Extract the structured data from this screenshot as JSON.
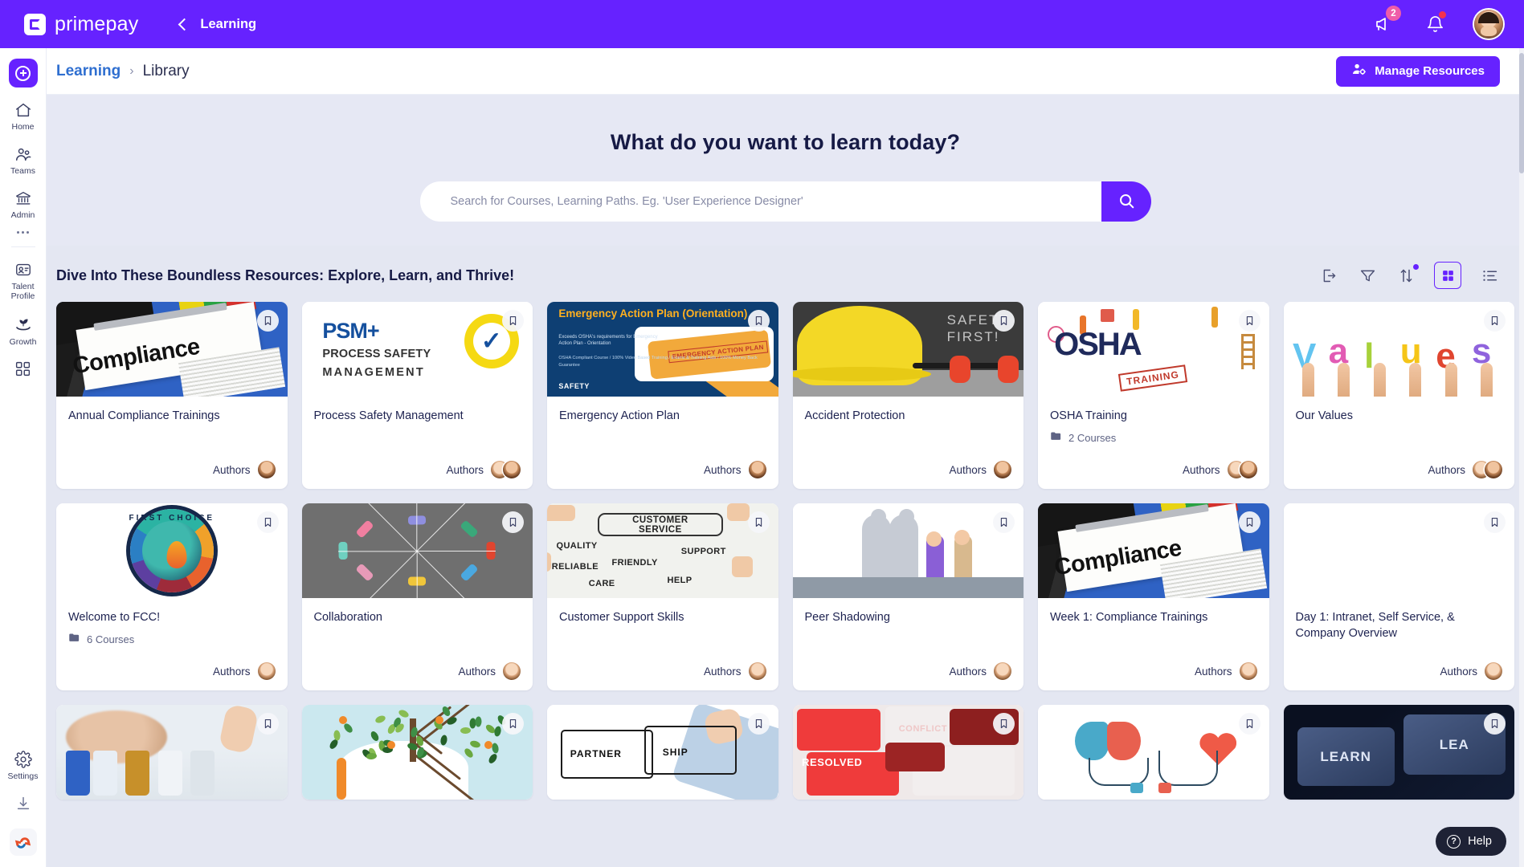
{
  "topbar": {
    "brand": "primepay",
    "back_label": "Learning",
    "notifications_badge": "2",
    "icons": [
      "megaphone-icon",
      "bell-icon",
      "user-avatar"
    ]
  },
  "sidebar": {
    "create_label": "create-button",
    "items": [
      {
        "label": "Home",
        "icon": "home-icon"
      },
      {
        "label": "Teams",
        "icon": "teams-icon"
      },
      {
        "label": "Admin",
        "icon": "admin-bank-icon"
      },
      {
        "label": "",
        "icon": "more-dots-icon"
      },
      {
        "label": "Talent Profile",
        "icon": "talent-profile-icon"
      },
      {
        "label": "Growth",
        "icon": "growth-plant-icon"
      },
      {
        "label": "",
        "icon": "apps-grid-icon"
      }
    ],
    "bottom_items": [
      {
        "label": "Settings",
        "icon": "gear-icon"
      },
      {
        "label": "",
        "icon": "download-icon"
      },
      {
        "label": "",
        "icon": "company-logo-icon"
      }
    ]
  },
  "breadcrumb": {
    "parent": "Learning",
    "separator": "›",
    "current": "Library"
  },
  "actions": {
    "manage_resources": "Manage Resources"
  },
  "hero": {
    "title": "What do you want to learn today?",
    "search_placeholder": "Search for Courses, Learning Paths. Eg. 'User Experience Designer'",
    "search_value": "",
    "search_button": "search-icon"
  },
  "section": {
    "title": "Dive Into These Boundless Resources: Explore, Learn, and Thrive!",
    "tools": [
      {
        "name": "export-icon",
        "active": false,
        "badge": false
      },
      {
        "name": "filter-icon",
        "active": false,
        "badge": false
      },
      {
        "name": "sort-icon",
        "active": false,
        "badge": true
      },
      {
        "name": "grid-view-icon",
        "active": true,
        "badge": false
      },
      {
        "name": "list-view-icon",
        "active": false,
        "badge": false
      }
    ]
  },
  "labels": {
    "authors": "Authors",
    "bookmark": "bookmark-icon",
    "folder": "folder-icon"
  },
  "cards": [
    {
      "title": "Annual Compliance Trainings",
      "meta": "",
      "authors": [
        "m"
      ],
      "art": "compliance"
    },
    {
      "title": "Process Safety Management",
      "meta": "",
      "authors": [
        "f",
        "m"
      ],
      "art": "psm"
    },
    {
      "title": "Emergency Action Plan",
      "meta": "",
      "authors": [
        "m"
      ],
      "art": "eap"
    },
    {
      "title": "Accident Protection",
      "meta": "",
      "authors": [
        "m"
      ],
      "art": "hat"
    },
    {
      "title": "OSHA Training",
      "meta": "2 Courses",
      "authors": [
        "f",
        "m"
      ],
      "art": "osha"
    },
    {
      "title": "Our Values",
      "meta": "",
      "authors": [
        "f",
        "m"
      ],
      "art": "values"
    },
    {
      "title": "Welcome to FCC!",
      "meta": "6 Courses",
      "authors": [
        "f"
      ],
      "art": "fcc"
    },
    {
      "title": "Collaboration",
      "meta": "",
      "authors": [
        "f"
      ],
      "art": "collab"
    },
    {
      "title": "Customer Support Skills",
      "meta": "",
      "authors": [
        "f"
      ],
      "art": "cs"
    },
    {
      "title": "Peer Shadowing",
      "meta": "",
      "authors": [
        "f"
      ],
      "art": "peer"
    },
    {
      "title": "Week 1: Compliance Trainings",
      "meta": "",
      "authors": [
        "f"
      ],
      "art": "compliance"
    },
    {
      "title": "Day 1: Intranet, Self Service, & Company Overview",
      "meta": "",
      "authors": [
        "f"
      ],
      "art": "white"
    },
    {
      "title": "",
      "meta": "",
      "authors": [],
      "art": "meds"
    },
    {
      "title": "",
      "meta": "",
      "authors": [],
      "art": "tree"
    },
    {
      "title": "",
      "meta": "",
      "authors": [],
      "art": "puzzle"
    },
    {
      "title": "",
      "meta": "",
      "authors": [],
      "art": "conflict"
    },
    {
      "title": "",
      "meta": "",
      "authors": [],
      "art": "brain"
    },
    {
      "title": "",
      "meta": "",
      "authors": [],
      "art": "learn"
    }
  ],
  "eap_art_text": {
    "heading": "Emergency Action Plan (Orientation)",
    "sub": "Exceeds OSHA's requirements for Emergency Action Plan - Orientation",
    "bullets": "OSHA Compliant Course / 100% Video Based Training / Exams & Training Aids / 100% Money Back Guarantee",
    "brand": "SAFETY",
    "tag": "EMERGENCY ACTION PLAN"
  },
  "psm_art_text": {
    "line1": "PSM+",
    "line2": "PROCESS SAFETY",
    "line3": "MANAGEMENT",
    "seal": "PROCESS SAFETY"
  },
  "osha_art_text": {
    "word": "OSHA",
    "stamp": "TRAINING"
  },
  "values_art_text": {
    "word": "Values"
  },
  "fcc_art_text": {
    "word": "FIRST CHOICE"
  },
  "cs_art_text": {
    "center1": "CUSTOMER",
    "center2": "SERVICE",
    "w1": "QUALITY",
    "w2": "SUPPORT",
    "w3": "RELIABLE",
    "w4": "FRIENDLY",
    "w5": "CARE",
    "w6": "HELP"
  },
  "puzzle_art_text": {
    "a": "PARTNER",
    "b": "SHIP"
  },
  "conflict_art_text": {
    "a": "RESOLVED",
    "b": "CONFLICT"
  },
  "learn_art_text": {
    "a": "LEARN",
    "b": "LEA"
  },
  "compliance_art_text": {
    "word": "Compliance"
  },
  "hat_art_text": {
    "line1": "SAFETY",
    "line2": "FIRST!"
  },
  "help": {
    "label": "Help",
    "icon": "question-circle-icon"
  }
}
